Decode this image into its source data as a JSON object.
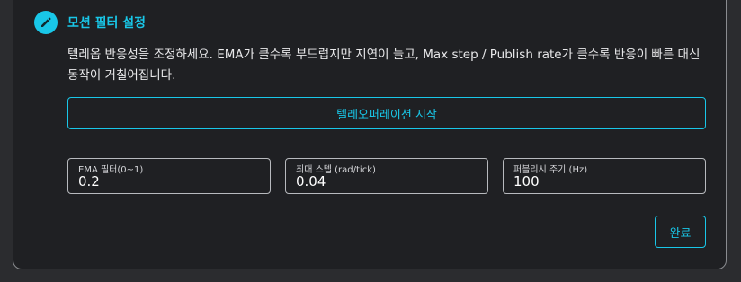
{
  "step": {
    "icon": "edit-pencil-icon",
    "title": "모션 필터 설정"
  },
  "description": "텔레옵 반응성을 조정하세요. EMA가 클수록 부드럽지만 지연이 늘고, Max step / Publish rate가 클수록 반응이 빠른 대신 동작이 거칠어집니다.",
  "start_button_label": "텔레오퍼레이션 시작",
  "fields": {
    "ema": {
      "label": "EMA 필터(0~1)",
      "value": "0.2"
    },
    "max_step": {
      "label": "최대 스텝 (rad/tick)",
      "value": "0.04"
    },
    "publish_rate": {
      "label": "퍼블리시 주기 (Hz)",
      "value": "100"
    }
  },
  "done_button_label": "완료",
  "colors": {
    "accent": "#19c7e8",
    "panel_bg": "#1f2023",
    "page_bg": "#2b2c2f"
  }
}
